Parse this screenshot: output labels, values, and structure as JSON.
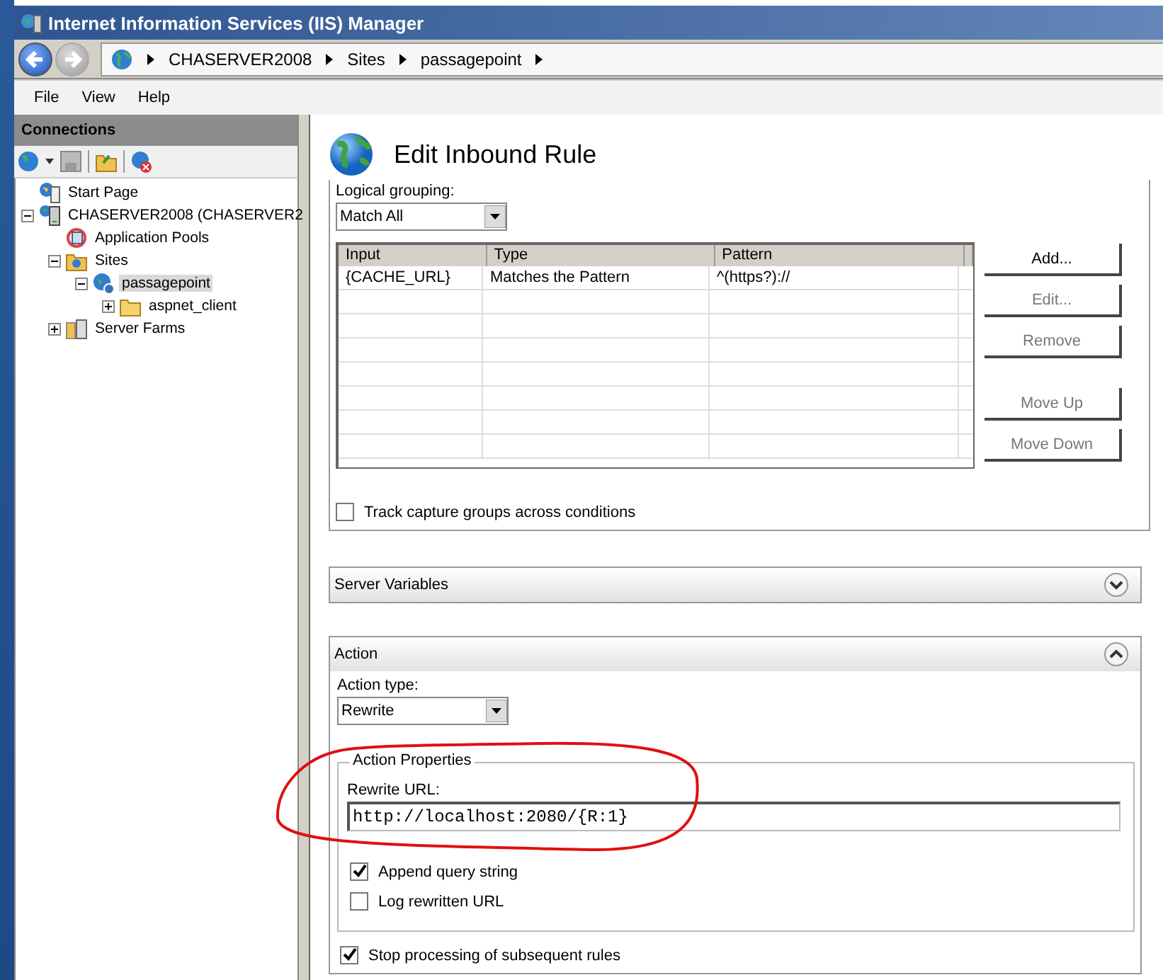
{
  "window": {
    "title": "Internet Information Services (IIS) Manager"
  },
  "breadcrumb": [
    "CHASERVER2008",
    "Sites",
    "passagepoint"
  ],
  "menu": [
    "File",
    "View",
    "Help"
  ],
  "connections": {
    "title": "Connections",
    "tree": [
      {
        "label": "Start Page",
        "kind": "start",
        "selected": false
      },
      {
        "label": "CHASERVER2008 (CHASERVER2",
        "kind": "server",
        "selected": false,
        "expanded": true,
        "children": [
          {
            "label": "Application Pools",
            "kind": "pools",
            "selected": false
          },
          {
            "label": "Sites",
            "kind": "sites",
            "selected": false,
            "expanded": true,
            "children": [
              {
                "label": "passagepoint",
                "kind": "site",
                "selected": true,
                "expanded": true,
                "children": [
                  {
                    "label": "aspnet_client",
                    "kind": "folder",
                    "selected": false,
                    "expanded": false
                  }
                ]
              }
            ]
          },
          {
            "label": "Server Farms",
            "kind": "farms",
            "selected": false,
            "expanded": false
          }
        ]
      }
    ]
  },
  "page": {
    "title": "Edit Inbound Rule",
    "conditions": {
      "grouping_label": "Logical grouping:",
      "grouping_value": "Match All",
      "columns": [
        "Input",
        "Type",
        "Pattern"
      ],
      "rows": [
        [
          "{CACHE_URL}",
          "Matches the Pattern",
          "^(https?)://"
        ]
      ],
      "buttons": [
        {
          "label": "Add...",
          "disabled": false
        },
        {
          "label": "Edit...",
          "disabled": true
        },
        {
          "label": "Remove",
          "disabled": true
        },
        {
          "label": "Move Up",
          "disabled": true
        },
        {
          "label": "Move Down",
          "disabled": true
        }
      ],
      "track_capture": {
        "label": "Track capture groups across conditions",
        "checked": false
      }
    },
    "server_variables": {
      "title": "Server Variables",
      "expanded": false
    },
    "action": {
      "title": "Action",
      "expanded": true,
      "type_label": "Action type:",
      "type_value": "Rewrite",
      "properties_title": "Action Properties",
      "url_label": "Rewrite URL:",
      "url_value": "http://localhost:2080/{R:1}",
      "options": [
        {
          "label": "Append query string",
          "checked": true
        },
        {
          "label": "Log rewritten URL",
          "checked": false
        }
      ],
      "stop_processing": {
        "label": "Stop processing of subsequent rules",
        "checked": true
      }
    }
  }
}
